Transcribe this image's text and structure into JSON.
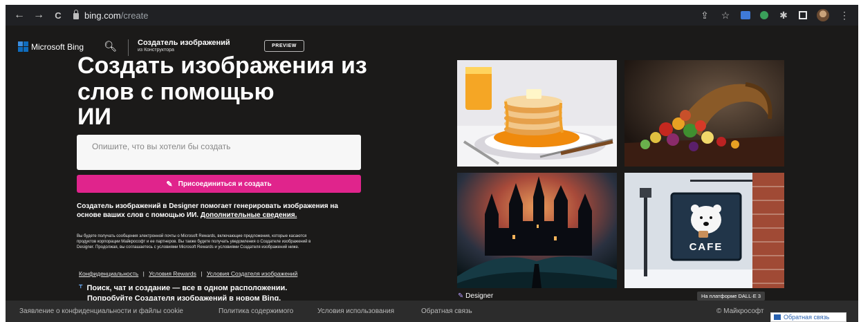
{
  "browser": {
    "url_host": "bing.com",
    "url_path": "/create",
    "back_glyph": "←",
    "forward_glyph": "→",
    "reload_glyph": "C",
    "share_glyph": "⇪",
    "star_glyph": "☆",
    "puzzle_glyph": "✱",
    "menu_glyph": "⋮"
  },
  "header": {
    "logo_text": "Microsoft Bing",
    "search_glyph": "🔍︎",
    "app_title": "Создатель изображений",
    "app_subtitle": "из Конструктора",
    "preview_label": "PREVIEW"
  },
  "hero": {
    "line1": "Создать изображения из",
    "line2": "слов с помощью",
    "line3": "ИИ"
  },
  "prompt": {
    "placeholder": "Опишите, что вы хотели бы создать"
  },
  "join_button": {
    "icon": "✎",
    "label": "Присоединиться и создать"
  },
  "description": {
    "text": "Создатель изображений в Designer помогает генерировать изображения на основе ваших слов с помощью ИИ. ",
    "link": "Дополнительные сведения."
  },
  "fine_print": "Вы будете получать сообщения электронной почты о Microsoft Rewards, включающие предложения, которые касаются продуктов корпорации Майкрософт и ее партнеров. Вы также будете получать уведомления о Создателе изображений в Designer. Продолжая, вы соглашаетесь с условиями Microsoft Rewards и условиями Создателя изображений ниже.",
  "legal_links": [
    "Конфиденциальность",
    "Условия Rewards",
    "Условия Создателя изображений"
  ],
  "legal_sep": "|",
  "tip": {
    "icon": "⸆",
    "text": "Поиск, чат и создание — все в одном расположении.",
    "link": "Попробуйте Создателя изображений в новом Bing."
  },
  "gallery": {
    "tile_names": [
      "pancakes-image",
      "cornucopia-image",
      "castle-image",
      "cafe-sign-image"
    ],
    "cafe_text": "CAFE",
    "designer_icon": "✎",
    "designer_label": "Designer",
    "dalle_badge": "На платформе DALL·E 3"
  },
  "footer": {
    "links": [
      "Заявление о конфиденциальности и файлы cookie",
      "Политика содержимого",
      "Условия использования",
      "Обратная связь"
    ],
    "copyright": "© Майкрософт",
    "feedback_button": "Обратная связь"
  },
  "colors": {
    "page_bg": "#1b1a19",
    "accent": "#e0248c",
    "chrome_bg": "#202124",
    "footer_bg": "#2c2c2c"
  }
}
